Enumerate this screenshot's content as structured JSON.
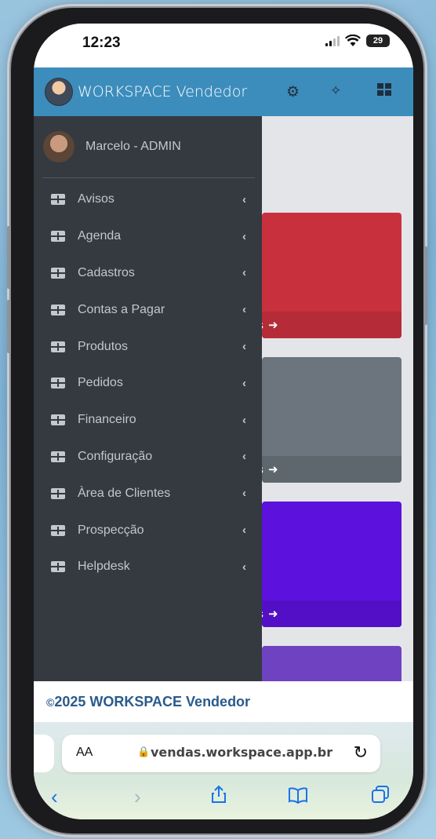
{
  "status_bar": {
    "time": "12:23",
    "battery": "29"
  },
  "brand": {
    "title": "WORKSPACE Vendedor"
  },
  "topbar_icons": [
    "gear-icon",
    "compress-icon",
    "grid-icon"
  ],
  "user": {
    "name": "Marcelo - ADMIN"
  },
  "menu": {
    "items": [
      {
        "label": "Avisos",
        "icon": "table-icon"
      },
      {
        "label": "Agenda",
        "icon": "table-icon"
      },
      {
        "label": "Cadastros",
        "icon": "table-icon"
      },
      {
        "label": "Contas a Pagar",
        "icon": "table-icon"
      },
      {
        "label": "Produtos",
        "icon": "table-icon"
      },
      {
        "label": "Pedidos",
        "icon": "table-icon"
      },
      {
        "label": "Financeiro",
        "icon": "table-icon"
      },
      {
        "label": "Configuração",
        "icon": "table-icon"
      },
      {
        "label": "Àrea de Clientes",
        "icon": "table-icon"
      },
      {
        "label": "Prospecção",
        "icon": "table-icon"
      },
      {
        "label": "Helpdesk",
        "icon": "table-icon"
      }
    ]
  },
  "cards": [
    {
      "color": "#c9303e",
      "footer_color": "#b52b38",
      "footer_text": "es"
    },
    {
      "color": "#6c757d",
      "footer_color": "#5f676e",
      "footer_text": "es"
    },
    {
      "color": "#5c11dc",
      "footer_color": "#520fc6",
      "footer_text": "es"
    },
    {
      "color": "#6f42c1",
      "footer_color": "#643bae",
      "footer_text": ""
    }
  ],
  "footer": {
    "copyright_symbol": "©",
    "text": "2025 WORKSPACE Vendedor"
  },
  "browser": {
    "aa_label": "AA",
    "url": "vendas.workspace.app.br"
  },
  "colors": {
    "primary": "#3c8dbc",
    "sidebar": "#343a40",
    "link": "#1a73e8"
  }
}
